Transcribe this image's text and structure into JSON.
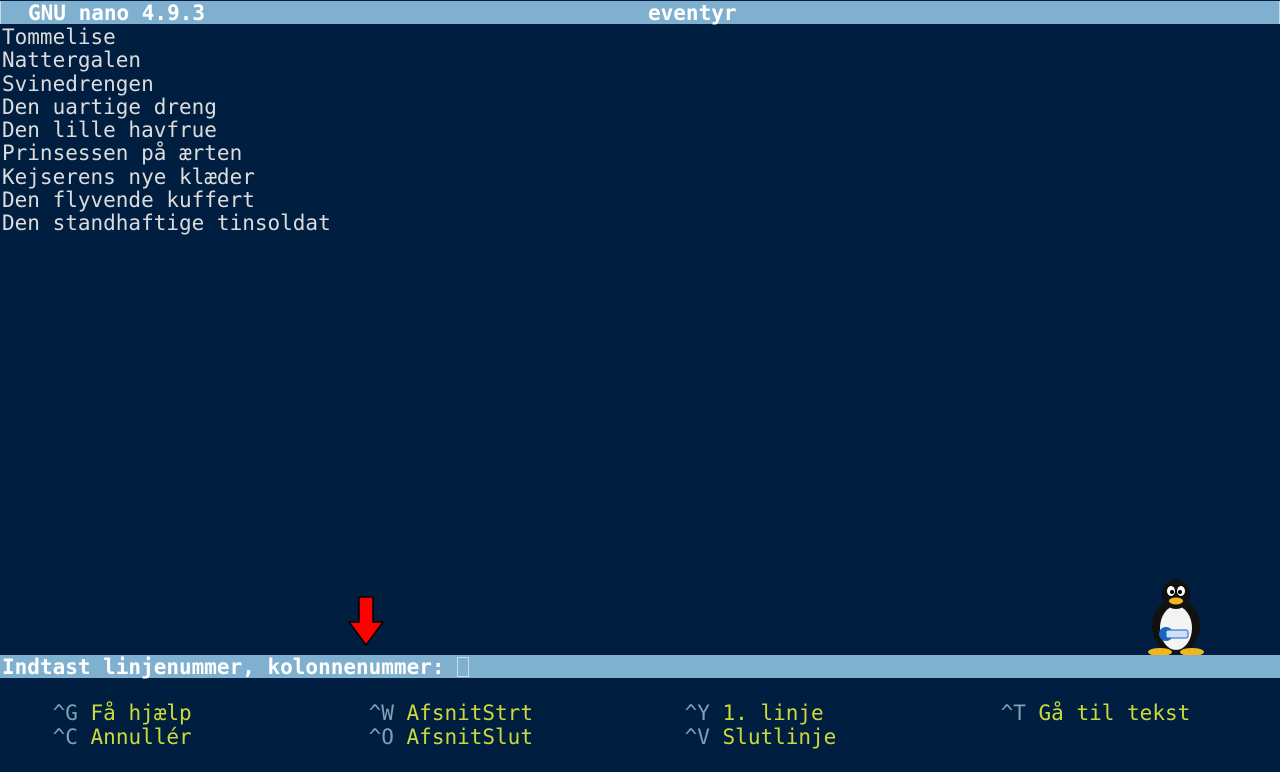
{
  "title_bar": {
    "version": "GNU nano 4.9.3",
    "filename": "eventyr"
  },
  "editor": {
    "lines": [
      "Tommelise",
      "Nattergalen",
      "Svinedrengen",
      "Den uartige dreng",
      "Den lille havfrue",
      "Prinsessen på ærten",
      "Kejserens nye klæder",
      "Den flyvende kuffert",
      "Den standhaftige tinsoldat"
    ]
  },
  "prompt": {
    "text": "Indtast linjenummer, kolonnenummer: "
  },
  "shortcuts": [
    {
      "key": "^G",
      "label": "Få hjælp"
    },
    {
      "key": "^W",
      "label": "AfsnitStrt"
    },
    {
      "key": "^Y",
      "label": "1. linje"
    },
    {
      "key": "^T",
      "label": "Gå til tekst"
    },
    {
      "key": "^C",
      "label": "Annullér"
    },
    {
      "key": "^O",
      "label": "AfsnitSlut"
    },
    {
      "key": "^V",
      "label": "Slutlinje"
    }
  ],
  "colors": {
    "background": "#001e3f",
    "bar": "#7fb0cf",
    "shortcut_key": "#7aa3b8",
    "shortcut_label": "#cbd93a",
    "arrow": "#ff0000"
  },
  "icons": {
    "arrow": "red-down-arrow-icon",
    "mascot": "tux-penguin-icon"
  }
}
